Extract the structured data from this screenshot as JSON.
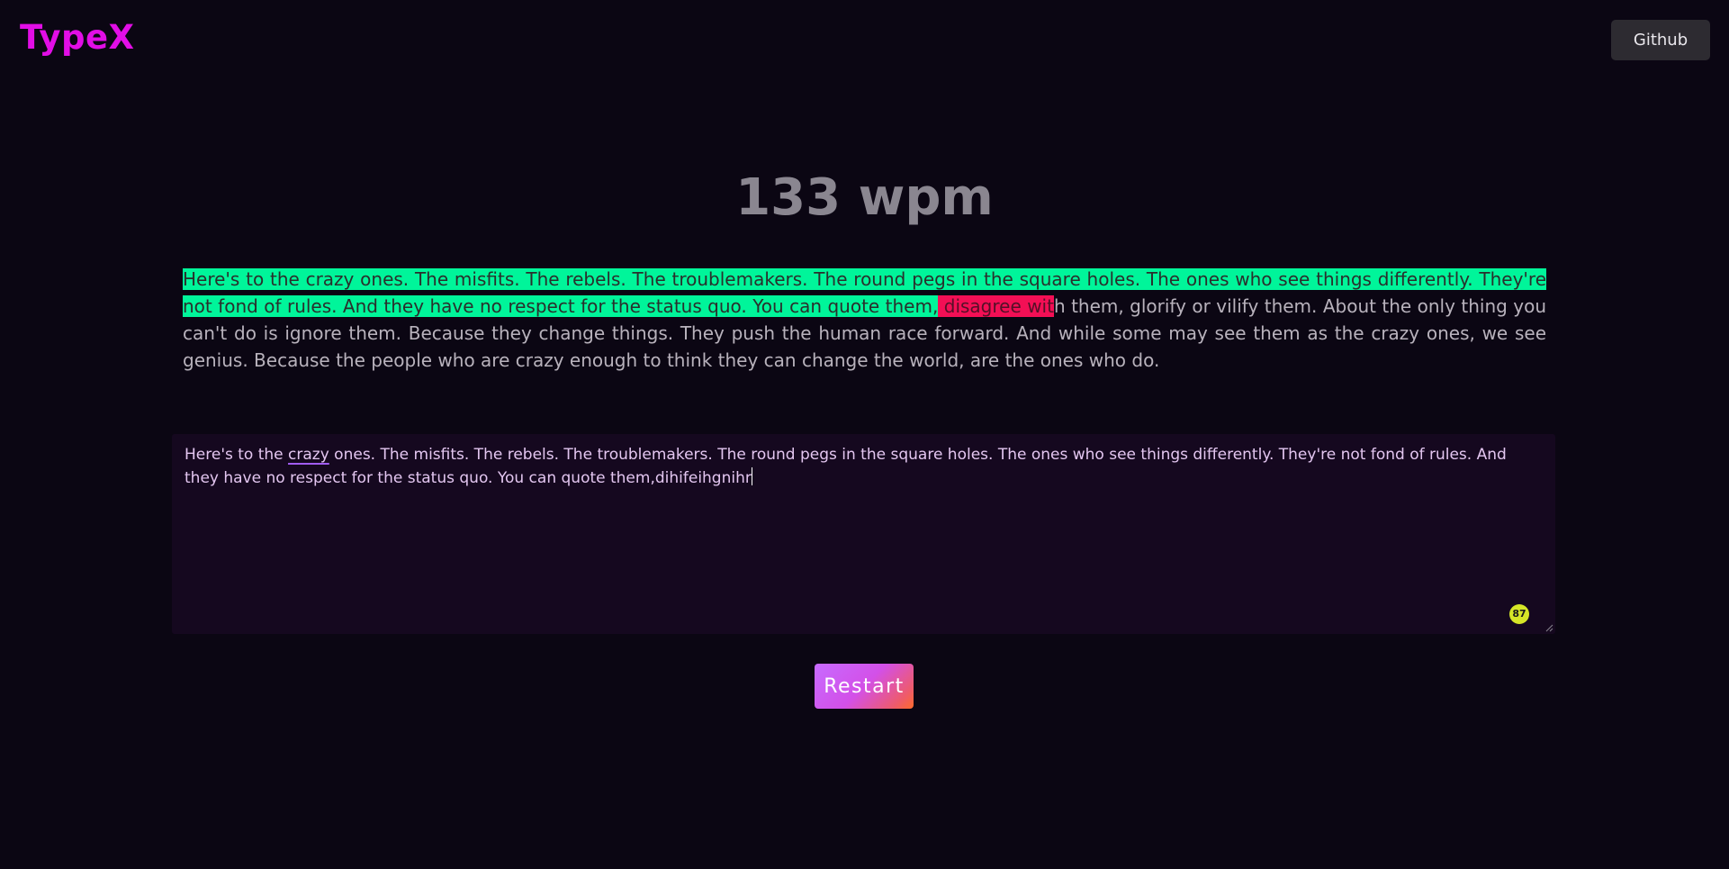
{
  "header": {
    "logo": "TypeX",
    "github_label": "Github"
  },
  "stats": {
    "wpm": "133 wpm"
  },
  "passage": {
    "correct_text": "Here's to the crazy ones. The misfits. The rebels. The troublemakers. The round pegs in the square holes. The ones who see things differently. They're not fond of rules. And they have no respect for the status quo. You can quote them,",
    "wrong_text": " disagree wit",
    "remaining_text": "h them, glorify or vilify them. About the only thing you can't do is ignore them. Because they change things. They push the human race forward. And while some may see them as the crazy ones, we see genius. Because the people who are crazy enough to think they can change the world, are the ones who do."
  },
  "input": {
    "before_underline": "Here's to the ",
    "underlined_word": "crazy",
    "after_underline": " ones. The misfits. The rebels. The troublemakers. The round pegs in the square holes. The ones who see things differently. They're not fond of rules. And they have no respect for the status quo. You can quote them,dihifeihgnihr",
    "badge_count": "87"
  },
  "actions": {
    "restart_label": "Restart"
  },
  "colors": {
    "logo": "#e20ee6",
    "correct_highlight": "#00f59a",
    "wrong_highlight": "#f30f55",
    "badge": "#d6e627"
  }
}
